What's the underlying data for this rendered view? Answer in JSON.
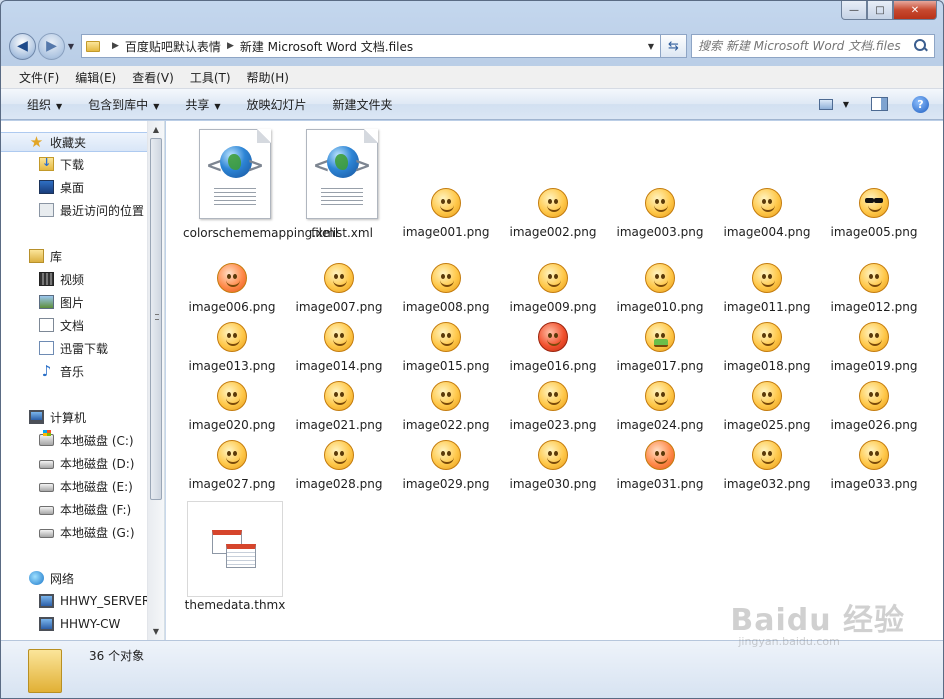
{
  "window": {
    "caption": {
      "minimize": "—",
      "maximize": "□",
      "close": "✕"
    }
  },
  "address": {
    "crumbs": [
      "百度贴吧默认表情",
      "新建 Microsoft Word 文档.files"
    ],
    "search_placeholder": "搜索 新建 Microsoft Word 文档.files"
  },
  "menu": [
    "文件(F)",
    "编辑(E)",
    "查看(V)",
    "工具(T)",
    "帮助(H)"
  ],
  "commands": {
    "organize": "组织",
    "include_in_library": "包含到库中",
    "share": "共享",
    "slideshow": "放映幻灯片",
    "new_folder": "新建文件夹"
  },
  "nav": {
    "favorites": "收藏夹",
    "downloads": "下载",
    "desktop": "桌面",
    "recent": "最近访问的位置",
    "libraries": "库",
    "videos": "视频",
    "pictures": "图片",
    "documents": "文档",
    "thunder": "迅雷下载",
    "music": "音乐",
    "computer": "计算机",
    "drives": [
      "本地磁盘 (C:)",
      "本地磁盘 (D:)",
      "本地磁盘 (E:)",
      "本地磁盘 (F:)",
      "本地磁盘 (G:)"
    ],
    "network": "网络",
    "hosts": [
      "HHWY_SERVER",
      "HHWY-CW"
    ]
  },
  "files": {
    "top": [
      "colorschememapping.xml",
      "filelist.xml"
    ],
    "images": [
      "image001.png",
      "image002.png",
      "image003.png",
      "image004.png",
      "image005.png",
      "image006.png",
      "image007.png",
      "image008.png",
      "image009.png",
      "image010.png",
      "image011.png",
      "image012.png",
      "image013.png",
      "image014.png",
      "image015.png",
      "image016.png",
      "image017.png",
      "image018.png",
      "image019.png",
      "image020.png",
      "image021.png",
      "image022.png",
      "image023.png",
      "image024.png",
      "image025.png",
      "image026.png",
      "image027.png",
      "image028.png",
      "image029.png",
      "image030.png",
      "image031.png",
      "image032.png",
      "image033.png"
    ],
    "theme": "themedata.thmx"
  },
  "status": {
    "count": "36 个对象"
  },
  "watermark": {
    "line1": "Baidu 经验",
    "line2": "jingyan.baidu.com"
  }
}
